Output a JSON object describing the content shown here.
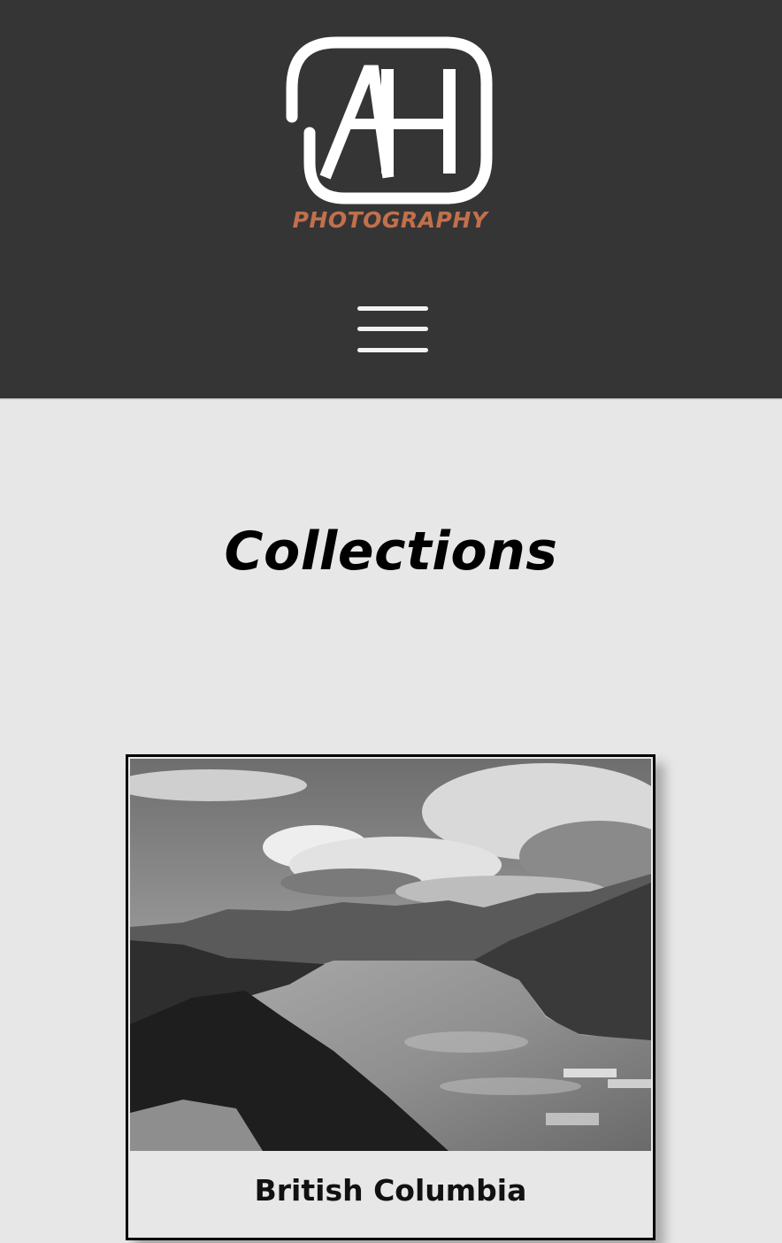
{
  "header": {
    "logo_letters": "AH",
    "logo_subtitle": "PHOTOGRAPHY",
    "menu_icon": "hamburger-menu-icon"
  },
  "main": {
    "title": "Collections",
    "collections": [
      {
        "label": "British Columbia",
        "image": "black-and-white landscape of a fjord with mountains and clouds"
      }
    ]
  },
  "colors": {
    "header_bg": "#363536",
    "page_bg": "#e7e7e7",
    "accent": "#c1704c"
  }
}
